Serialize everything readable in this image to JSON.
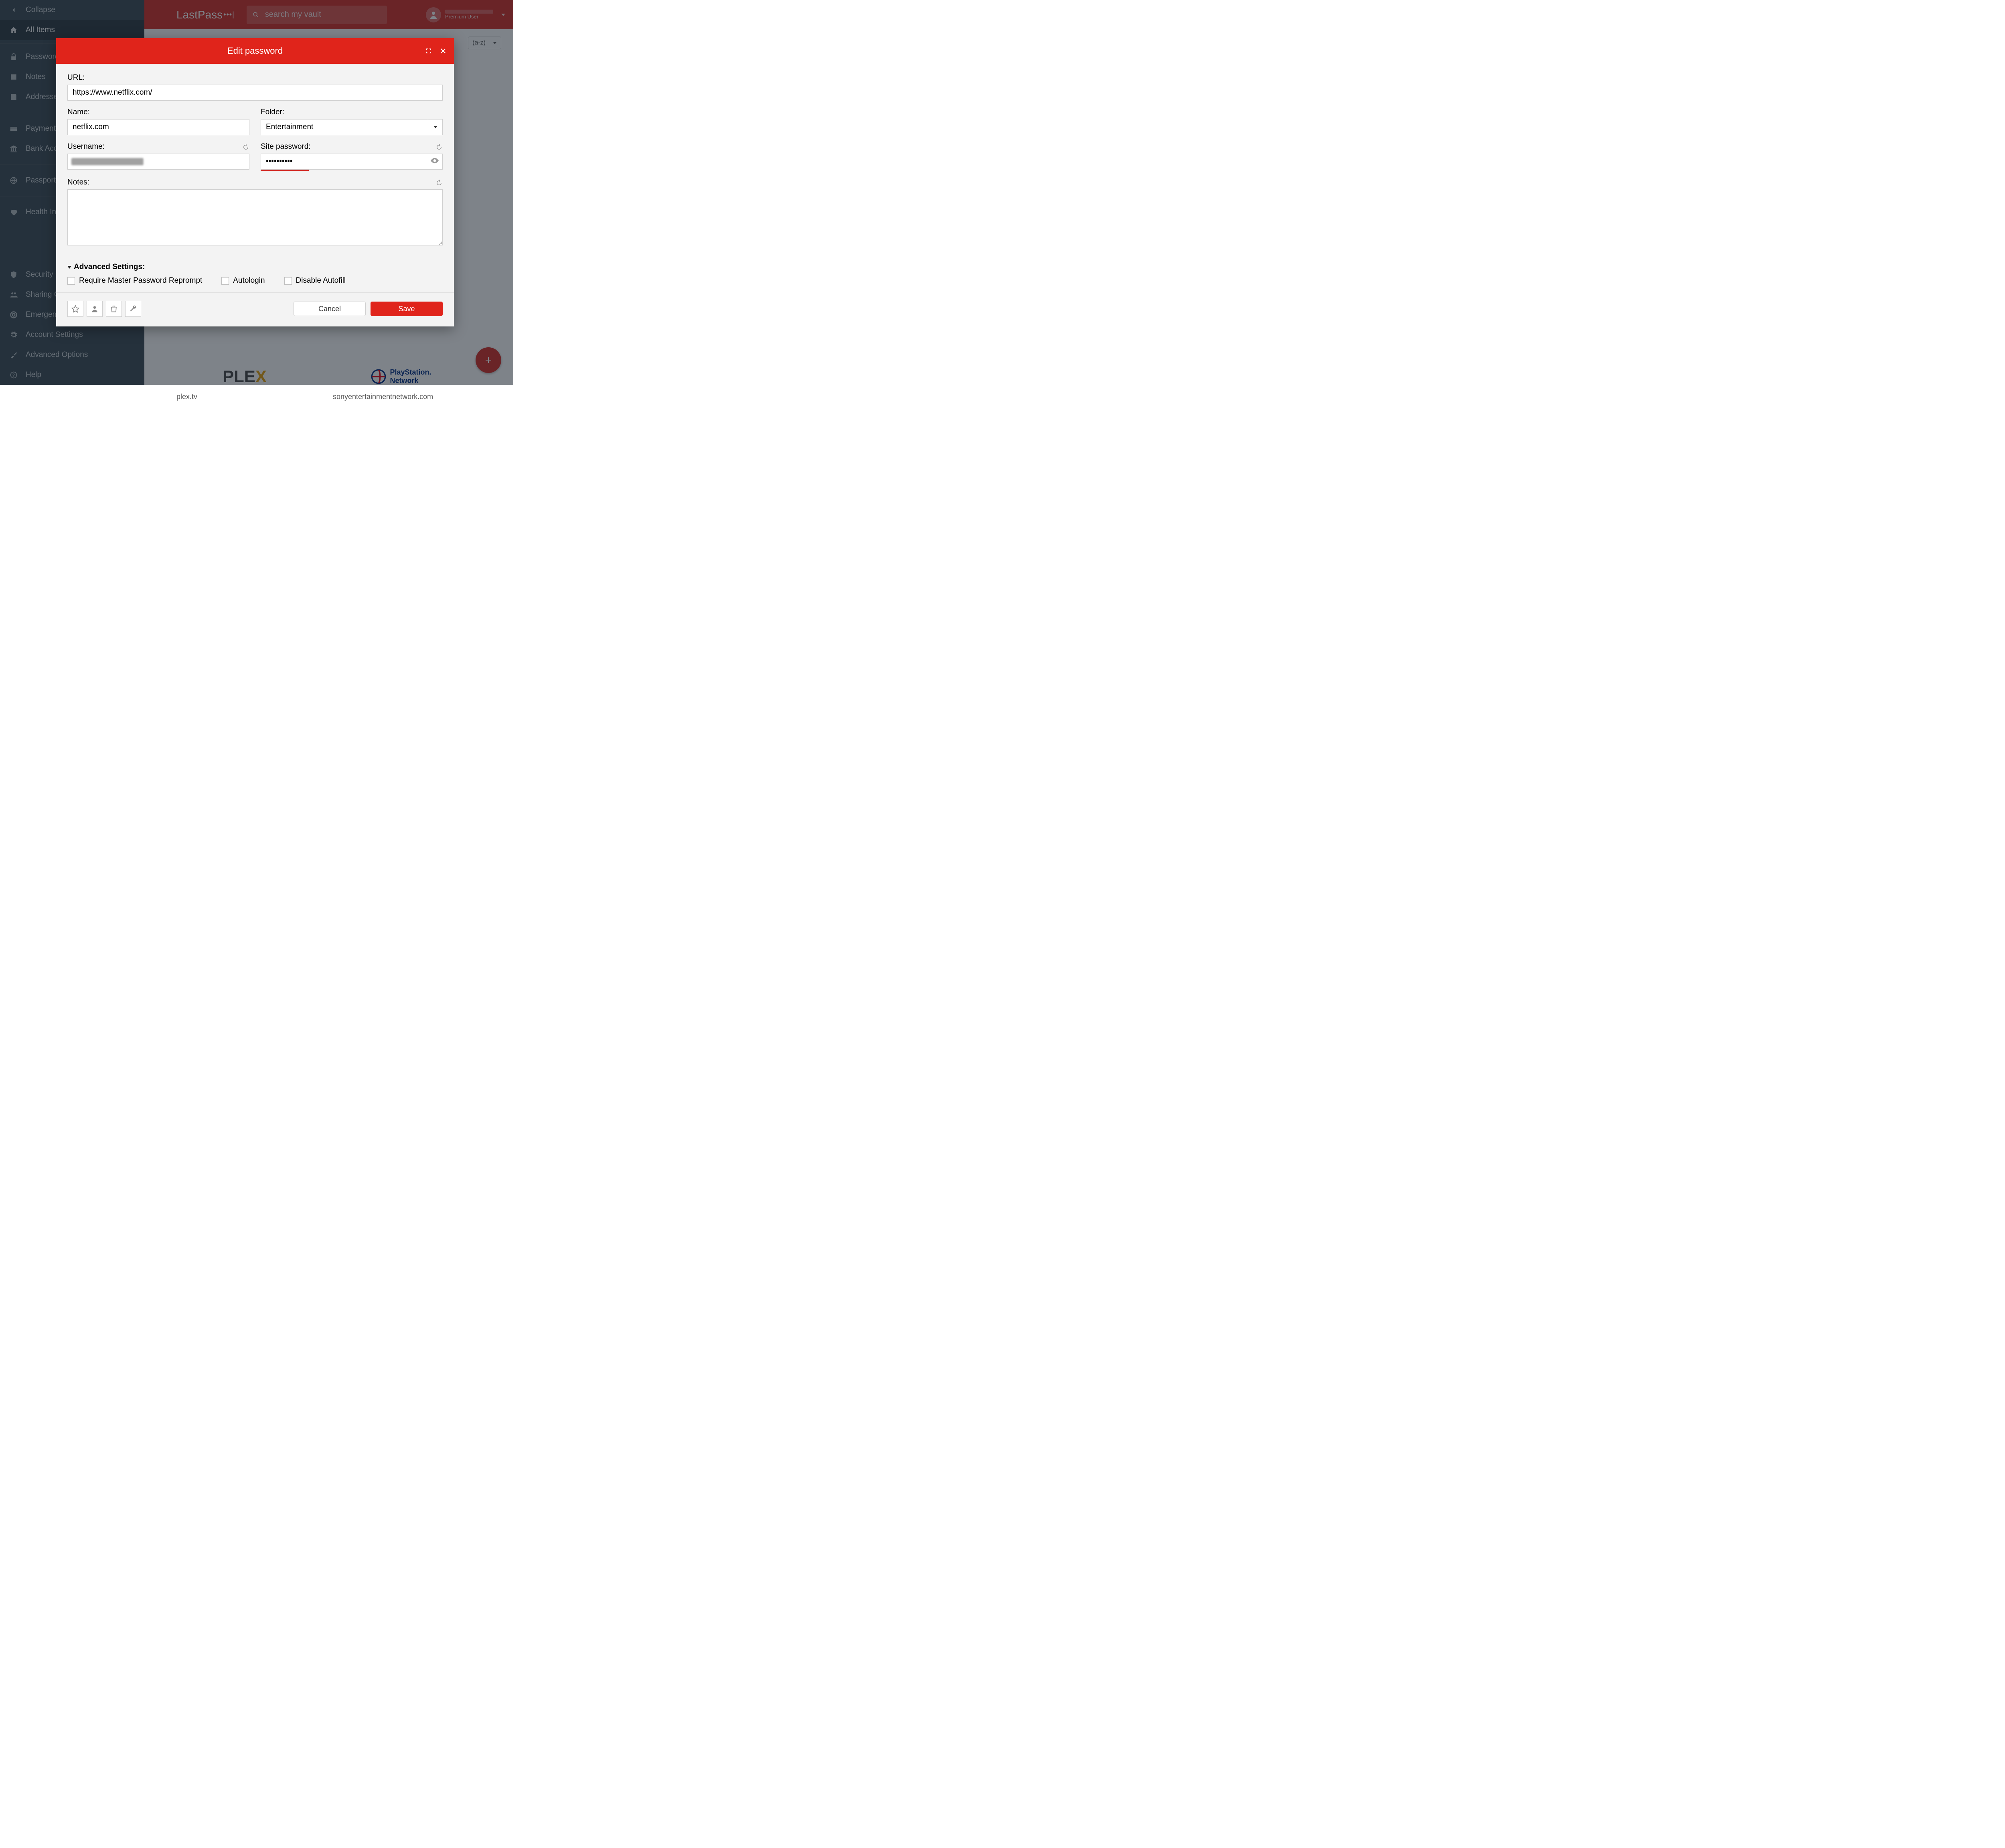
{
  "header": {
    "logo_text": "LastPass",
    "logo_dots": "•••|",
    "search_placeholder": "search my vault",
    "user_premium": "Premium User"
  },
  "sidebar": {
    "collapse": "Collapse",
    "items": [
      {
        "label": "All Items"
      },
      {
        "label": "Passwords"
      },
      {
        "label": "Notes"
      },
      {
        "label": "Addresses"
      },
      {
        "label": "Payment Cards"
      },
      {
        "label": "Bank Accounts"
      },
      {
        "label": "Passports"
      },
      {
        "label": "Health Insurance"
      }
    ],
    "bottom_items": [
      {
        "label": "Security Challenge"
      },
      {
        "label": "Sharing Center"
      },
      {
        "label": "Emergency Access"
      },
      {
        "label": "Account Settings"
      },
      {
        "label": "Advanced Options"
      },
      {
        "label": "Help"
      }
    ]
  },
  "main": {
    "sort_label": "(a-z)",
    "tiles": [
      {
        "logo_text": "PLEX",
        "url": "plex.tv"
      },
      {
        "logo_text": "PlayStation Network",
        "url": "sonyentertainmentnetwork.com"
      }
    ]
  },
  "dialog": {
    "title": "Edit password",
    "url_label": "URL:",
    "url_value": "https://www.netflix.com/",
    "name_label": "Name:",
    "name_value": "netflix.com",
    "folder_label": "Folder:",
    "folder_value": "Entertainment",
    "username_label": "Username:",
    "username_value": "",
    "password_label": "Site password:",
    "password_value": "••••••••••",
    "notes_label": "Notes:",
    "notes_value": "",
    "advanced_label": "Advanced Settings:",
    "chk_reprompt": "Require Master Password Reprompt",
    "chk_autologin": "Autologin",
    "chk_disable_autofill": "Disable Autofill",
    "cancel_label": "Cancel",
    "save_label": "Save"
  }
}
